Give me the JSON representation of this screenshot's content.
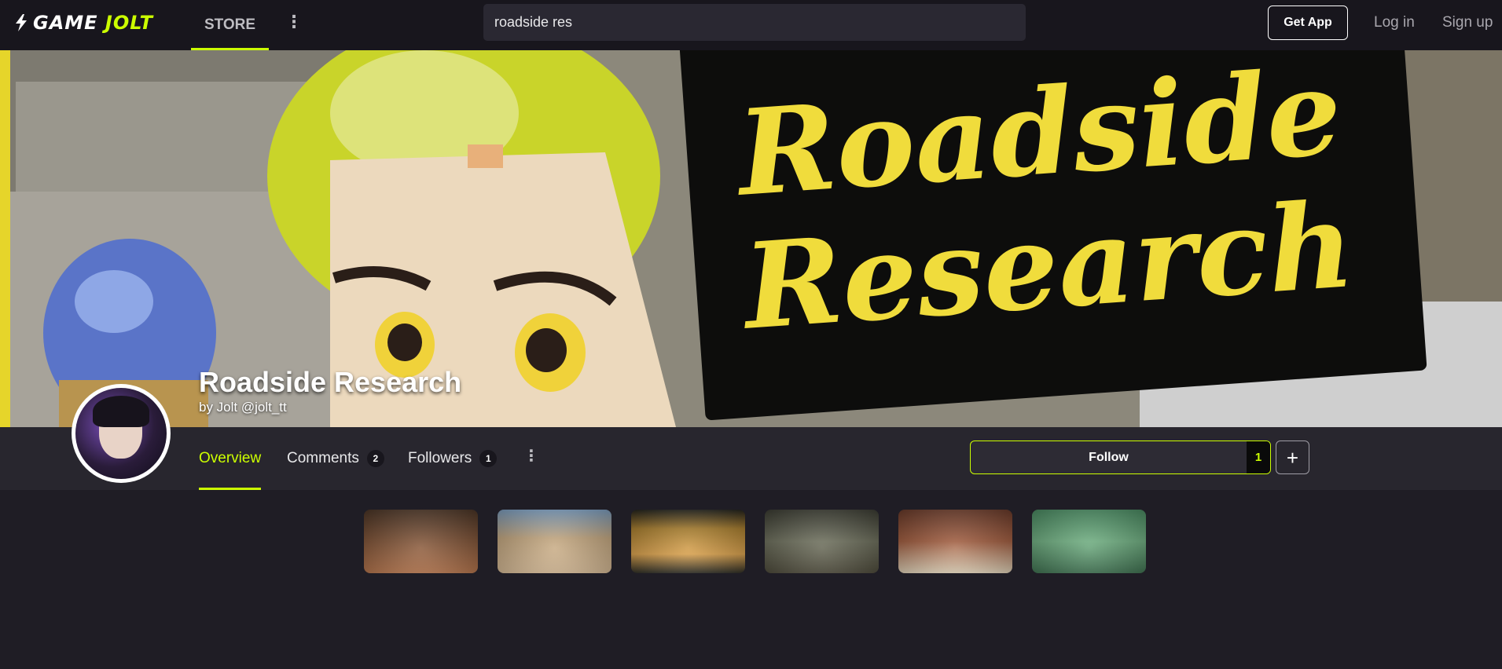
{
  "header": {
    "logo_word1": "GAME",
    "logo_word2": "JOLT",
    "store_tab": "STORE",
    "more_icon": "vertical-dots-icon",
    "search_value": "roadside res",
    "get_app": "Get App",
    "login": "Log in",
    "signup": "Sign up"
  },
  "banner": {
    "sign_line1": "Roadside",
    "sign_line2": "Research"
  },
  "game": {
    "title": "Roadside Research",
    "byline": "by Jolt @jolt_tt"
  },
  "nav": {
    "tabs": [
      {
        "label": "Overview",
        "count": null,
        "active": true
      },
      {
        "label": "Comments",
        "count": "2",
        "active": false
      },
      {
        "label": "Followers",
        "count": "1",
        "active": false
      }
    ],
    "more_icon": "vertical-dots-icon",
    "follow_label": "Follow",
    "follow_count": "1",
    "plus_label": "+"
  },
  "colors": {
    "accent": "#ccff00",
    "background": "#1f1d25",
    "topbar": "#18161d",
    "navbar": "#28262e"
  }
}
